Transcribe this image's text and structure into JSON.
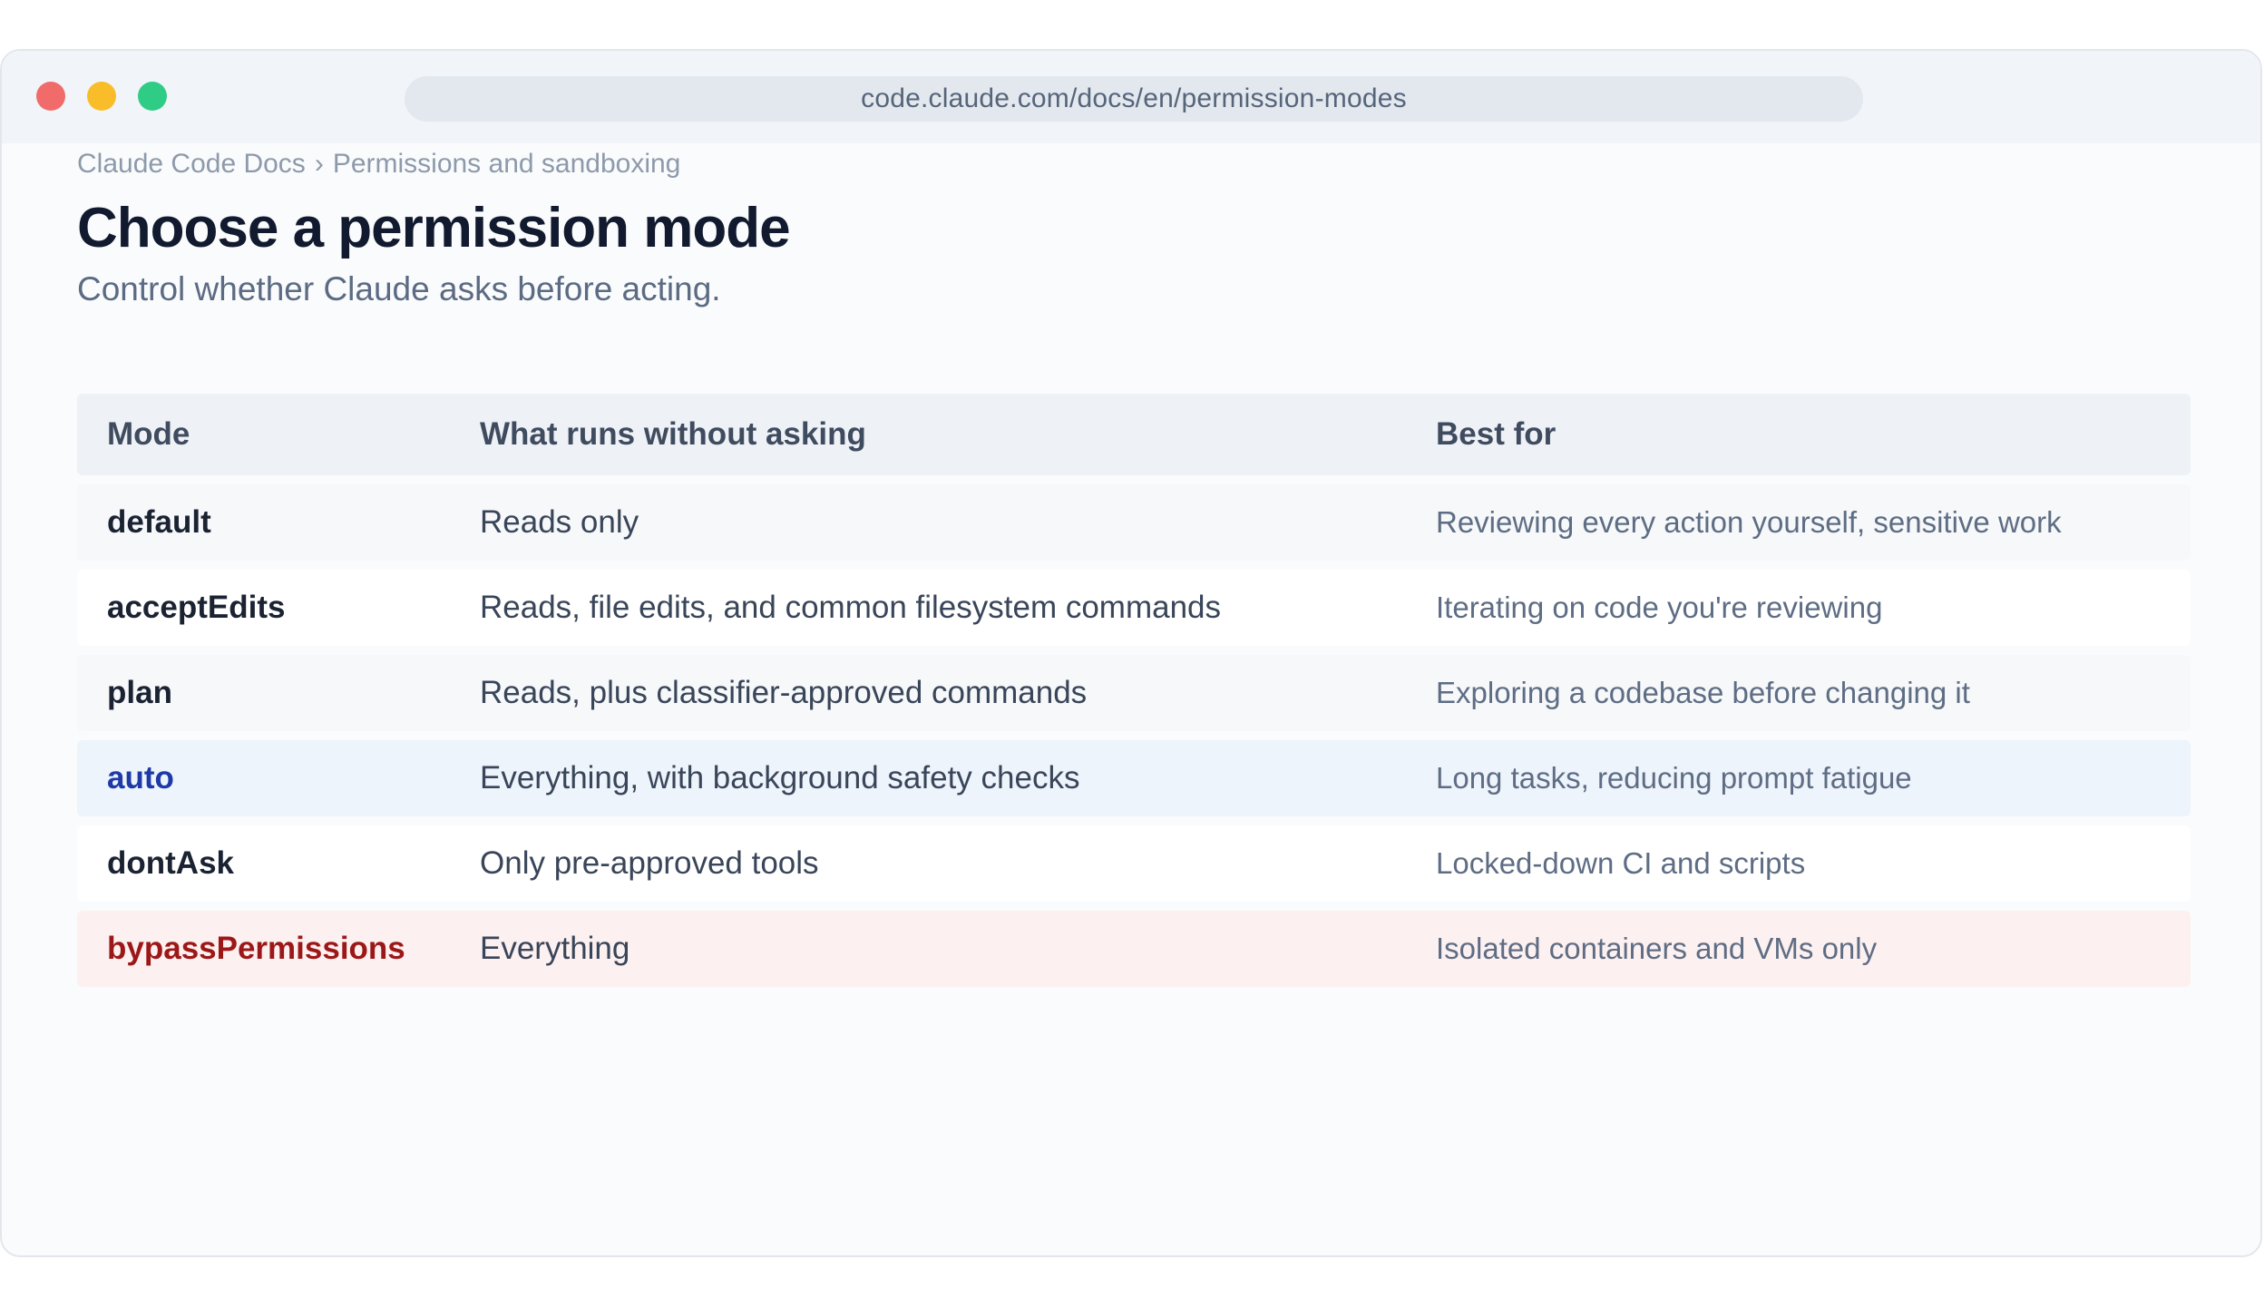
{
  "window": {
    "controls": [
      "close",
      "minimize",
      "maximize"
    ],
    "url": "code.claude.com/docs/en/permission-modes"
  },
  "breadcrumb": {
    "items": [
      "Claude Code Docs",
      "Permissions and sandboxing"
    ],
    "separator": "›"
  },
  "page": {
    "title": "Choose a permission mode",
    "subtitle": "Control whether Claude asks before acting."
  },
  "table": {
    "headers": [
      "Mode",
      "What runs without asking",
      "Best for"
    ],
    "rows": [
      {
        "mode": "default",
        "runs": "Reads only",
        "best_for": "Reviewing every action yourself, sensitive work"
      },
      {
        "mode": "acceptEdits",
        "runs": "Reads, file edits, and common filesystem commands",
        "best_for": "Iterating on code you're reviewing"
      },
      {
        "mode": "plan",
        "runs": "Reads, plus classifier-approved commands",
        "best_for": "Exploring a codebase before changing it"
      },
      {
        "mode": "auto",
        "runs": "Everything, with background safety checks",
        "best_for": "Long tasks, reducing prompt fatigue",
        "highlight": "blue"
      },
      {
        "mode": "dontAsk",
        "runs": "Only pre-approved tools",
        "best_for": "Locked-down CI and scripts"
      },
      {
        "mode": "bypassPermissions",
        "runs": "Everything",
        "best_for": "Isolated containers and VMs only",
        "highlight": "red"
      }
    ]
  },
  "colors": {
    "auto_mode_text": "#1d3aa8",
    "auto_row_bg": "#eef4fc",
    "bypass_mode_text": "#9c1818",
    "bypass_row_bg": "#fdf0f0",
    "close": "#f26b6b",
    "minimize": "#f9bd2a",
    "maximize": "#2fcc86"
  }
}
